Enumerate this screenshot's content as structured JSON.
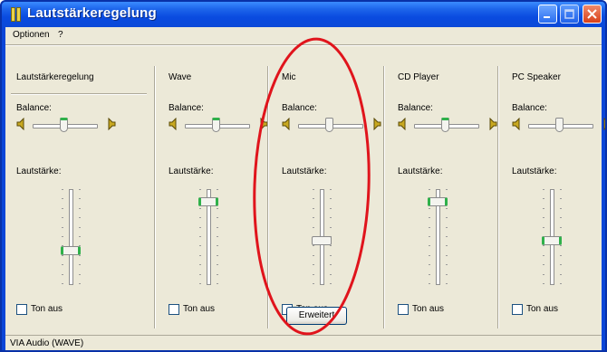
{
  "window": {
    "title": "Lautstärkeregelung",
    "menu": [
      "Optionen",
      "?"
    ]
  },
  "columns": [
    {
      "name": "Lautstärkeregelung",
      "balance_label": "Balance:",
      "volume_label": "Lautstärke:",
      "mute_label": "Ton aus",
      "muted": false,
      "volume_level": 0.33,
      "balance": 0.0
    },
    {
      "name": "Wave",
      "balance_label": "Balance:",
      "volume_label": "Lautstärke:",
      "mute_label": "Ton aus",
      "muted": false,
      "volume_level": 0.9,
      "balance": 0.0
    },
    {
      "name": "Mic",
      "balance_label": "Balance:",
      "volume_label": "Lautstärke:",
      "mute_label": "Ton aus",
      "muted": false,
      "volume_level": 0.45,
      "balance": 0.0
    },
    {
      "name": "CD Player",
      "balance_label": "Balance:",
      "volume_label": "Lautstärke:",
      "mute_label": "Ton aus",
      "muted": false,
      "volume_level": 0.9,
      "balance": 0.0
    },
    {
      "name": "PC Speaker",
      "balance_label": "Balance:",
      "volume_label": "Lautstärke:",
      "mute_label": "Ton aus",
      "muted": false,
      "volume_level": 0.45,
      "balance": 0.0
    }
  ],
  "mic_button": {
    "label": "Erweitert"
  },
  "status": {
    "text": "VIA Audio (WAVE)"
  },
  "colors": {
    "titlebar": "#0a4be0",
    "face": "#ece9d8",
    "annotation": "#e0141c",
    "thumb_accent": "#2fb14a"
  },
  "icons": {
    "speaker_left": "speaker-left-icon",
    "speaker_right": "speaker-right-icon",
    "app": "volume-control-icon"
  }
}
